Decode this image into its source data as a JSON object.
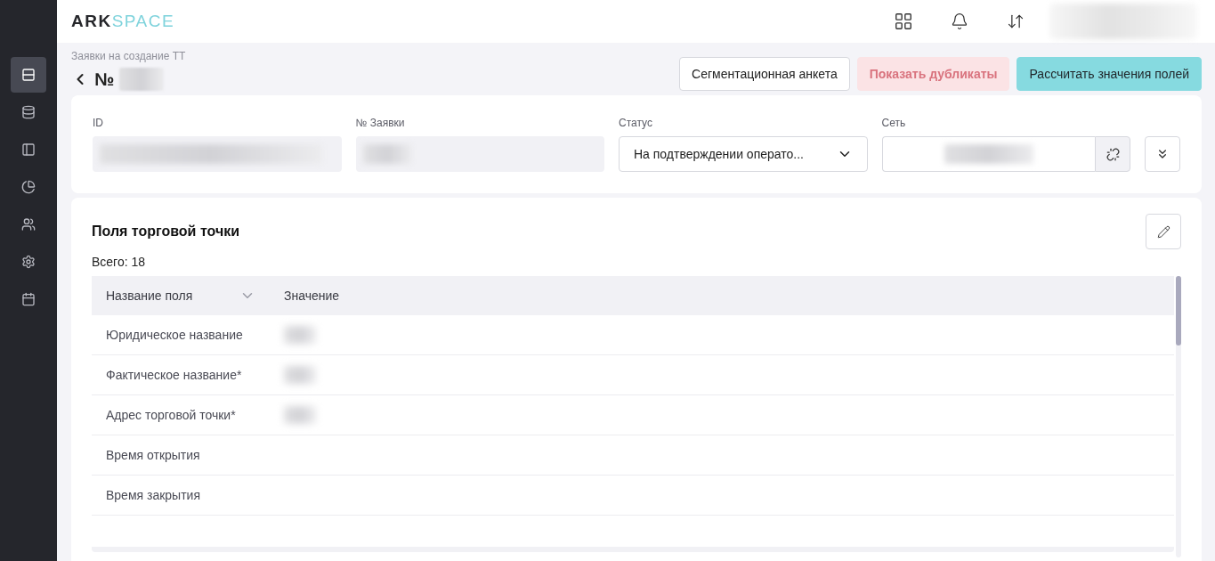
{
  "logo": {
    "dark": "ARK",
    "light": "SPACE"
  },
  "sidebar": {
    "items": [
      {
        "selected": true
      },
      {
        "selected": false
      },
      {
        "selected": false
      },
      {
        "selected": false
      },
      {
        "selected": false
      },
      {
        "selected": false
      },
      {
        "selected": false
      }
    ]
  },
  "breadcrumb": "Заявки на создание ТТ",
  "title": "№",
  "actions": [
    {
      "label": "Сегментационная анкета",
      "kind": "outline",
      "disabled": false
    },
    {
      "label": "Показать дубликаты",
      "kind": "danger",
      "disabled": true
    },
    {
      "label": "Рассчитать значения полей",
      "kind": "primary",
      "disabled": false
    }
  ],
  "filters": [
    {
      "label": "ID",
      "kind": "readonly"
    },
    {
      "label": "№ Заявки",
      "kind": "readonly"
    },
    {
      "label": "Статус",
      "kind": "select",
      "value": "На подтверждении операто..."
    },
    {
      "label": "Сеть",
      "kind": "linked"
    }
  ],
  "fields_card": {
    "title": "Поля торговой точки",
    "total": "Всего: 18",
    "columns": [
      "Название поля",
      "Значение"
    ],
    "rows": [
      {
        "name": "Юридическое название",
        "redacted": true
      },
      {
        "name": "Фактическое название*",
        "redacted": true
      },
      {
        "name": "Адрес торговой точки*",
        "redacted": true
      },
      {
        "name": "Время открытия",
        "redacted": false
      },
      {
        "name": "Время закрытия",
        "redacted": false
      }
    ]
  }
}
